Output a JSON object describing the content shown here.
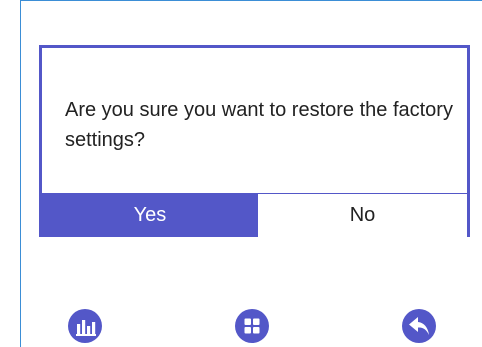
{
  "dialog": {
    "message": "Are you sure you want to restore the factory settings?",
    "yes_label": "Yes",
    "no_label": "No"
  },
  "toolbar": {
    "icons": [
      "bar-chart-icon",
      "grid-menu-icon",
      "back-arrow-icon"
    ]
  },
  "colors": {
    "accent": "#5357c8",
    "frame_border": "#3b8ed6"
  }
}
